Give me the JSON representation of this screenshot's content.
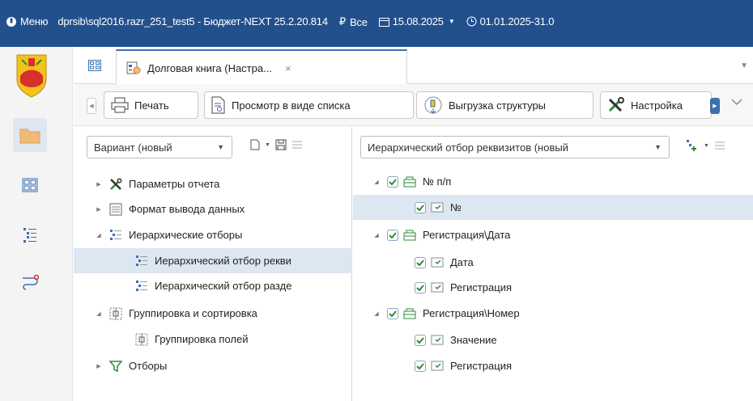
{
  "topbar": {
    "menu_label": "Меню",
    "connection": "dprsib\\sql2016.razr_251_test5 - Бюджет-NEXT 25.2.20.814",
    "budget_filter": "Все",
    "date": "15.08.2025",
    "period": "01.01.2025-31.0"
  },
  "tabs": [
    {
      "label": "Долговая книга (Настра...",
      "close": "×"
    }
  ],
  "toolbar": {
    "print": "Печать",
    "list_view": "Просмотр в виде списка",
    "export_structure": "Выгрузка структуры",
    "settings": "Настройка"
  },
  "left_panel": {
    "variant": "Вариант (новый",
    "tree": [
      {
        "label": "Параметры отчета",
        "icon": "tools-icon"
      },
      {
        "label": "Формат вывода данных",
        "icon": "format-icon"
      },
      {
        "label": "Иерархические отборы",
        "icon": "hierarchy-icon"
      },
      {
        "label": "Иерархический отбор рекви",
        "icon": "hierarchy-icon",
        "selected": true
      },
      {
        "label": "Иерархический отбор разде",
        "icon": "hierarchy-icon"
      },
      {
        "label": "Группировка и сортировка",
        "icon": "grouping-icon"
      },
      {
        "label": "Группировка полей",
        "icon": "grouping-icon"
      },
      {
        "label": "Отборы",
        "icon": "filter-icon"
      }
    ]
  },
  "right_panel": {
    "selector": "Иерархический отбор реквизитов (новый",
    "tree": [
      {
        "label": "№ п/п",
        "type": "group"
      },
      {
        "label": "№",
        "type": "field",
        "selected": true
      },
      {
        "label": "Регистрация\\Дата",
        "type": "group"
      },
      {
        "label": "Дата",
        "type": "field"
      },
      {
        "label": "Регистрация",
        "type": "field"
      },
      {
        "label": "Регистрация\\Номер",
        "type": "group"
      },
      {
        "label": "Значение",
        "type": "field"
      },
      {
        "label": "Регистрация",
        "type": "field"
      }
    ]
  },
  "colors": {
    "topbar": "#22508d",
    "accent": "#3a6fb0",
    "selection": "#dde7f1",
    "check_green": "#2e8b3a"
  }
}
